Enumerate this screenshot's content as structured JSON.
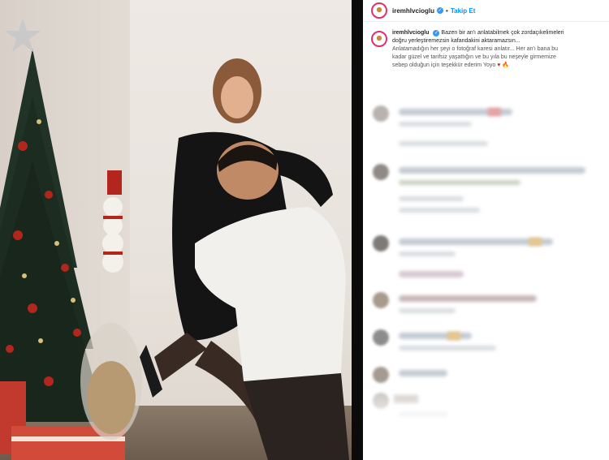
{
  "post": {
    "username": "iremhlvcioglu",
    "follow_label": "Takip Et",
    "separator": "•",
    "verified_mark": "✓"
  },
  "caption": {
    "username": "iremhlvcioglu",
    "text_line1": "Bazen bir an'ı anlatabilmek çok zordaçıkelimeleri",
    "text_line2": "doğru yerleştiremezsin kafandakini aktaramazsın...",
    "text_line3": "Anlatamadığın her şeyi o fotoğraf karesi anlatır... Her an'ı bana bu",
    "text_line4": "kadar güzel ve tarifsiz yaşattığın ve bu yıla bu neşeyle girmemize",
    "text_line5": "sebep olduğun için teşekkür ederim Yoyo",
    "emoji_heart": "♥",
    "emoji_fire": "🔥"
  },
  "comments": {
    "count_visible": 11,
    "blurred": true
  },
  "colors": {
    "follow_blue": "#0095f6",
    "username_text": "#262626",
    "avatar_ring": "#e1306c",
    "photo_background": "#e6dfd8"
  }
}
